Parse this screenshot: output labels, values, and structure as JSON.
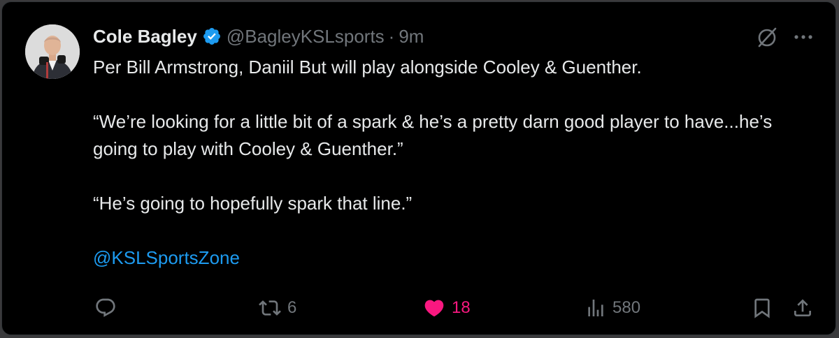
{
  "tweet": {
    "author": {
      "name": "Cole Bagley",
      "handle": "@BagleyKSLsports",
      "verified": true,
      "avatar": "avatar-photo"
    },
    "separator": "·",
    "time": "9m",
    "paragraphs": [
      "Per Bill Armstrong, Daniil But will play alongside Cooley & Guenther.",
      "“We’re looking for a little bit of a spark & he’s a pretty darn good player to have...he’s going to play with Cooley & Guenther.”",
      "“He’s going to hopefully spark that line.”"
    ],
    "mention": "@KSLSportsZone",
    "actions": {
      "reply": {
        "icon": "reply-icon",
        "count": ""
      },
      "repost": {
        "icon": "repost-icon",
        "count": "6"
      },
      "like": {
        "icon": "heart-icon",
        "count": "18",
        "liked": true,
        "color": "#f91880"
      },
      "views": {
        "icon": "views-icon",
        "count": "580"
      },
      "bookmark": {
        "icon": "bookmark-icon"
      },
      "share": {
        "icon": "share-icon"
      }
    },
    "header_icons": [
      "grok-icon",
      "more-icon"
    ]
  },
  "colors": {
    "background": "#000000",
    "text": "#e7e9ea",
    "muted": "#71767b",
    "accent": "#1d9bf0",
    "like": "#f91880"
  }
}
